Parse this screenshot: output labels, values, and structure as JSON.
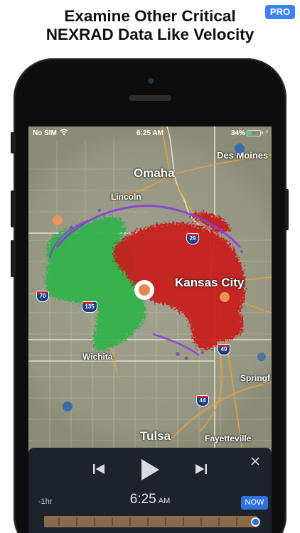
{
  "headline": {
    "line1": "Examine Other Critical",
    "line2": "NEXRAD Data Like Velocity"
  },
  "badge": "PRO",
  "status_bar": {
    "carrier": "No SIM",
    "time": "6:25 AM",
    "battery_percent": "34%",
    "battery_level": 0.34,
    "battery_color": "#4cd964"
  },
  "map": {
    "cities": [
      {
        "name": "Omaha"
      },
      {
        "name": "Des Moines"
      },
      {
        "name": "Lincoln"
      },
      {
        "name": "Kansas City"
      },
      {
        "name": "Wichita"
      },
      {
        "name": "Springf"
      },
      {
        "name": "Tulsa"
      },
      {
        "name": "Fayetteville"
      }
    ],
    "highways": [
      "29",
      "70",
      "135",
      "49",
      "44"
    ],
    "velocity_colors": {
      "inbound": "#22c55e",
      "outbound": "#c81e1e",
      "range_fold": "#8b3fd6"
    }
  },
  "player": {
    "range_label": "-1hr",
    "time": "6:25",
    "ampm": "AM",
    "now_label": "NOW",
    "accent": "#2f72db",
    "icons": [
      "skip-back-icon",
      "play-icon",
      "skip-forward-icon",
      "close-icon"
    ]
  }
}
